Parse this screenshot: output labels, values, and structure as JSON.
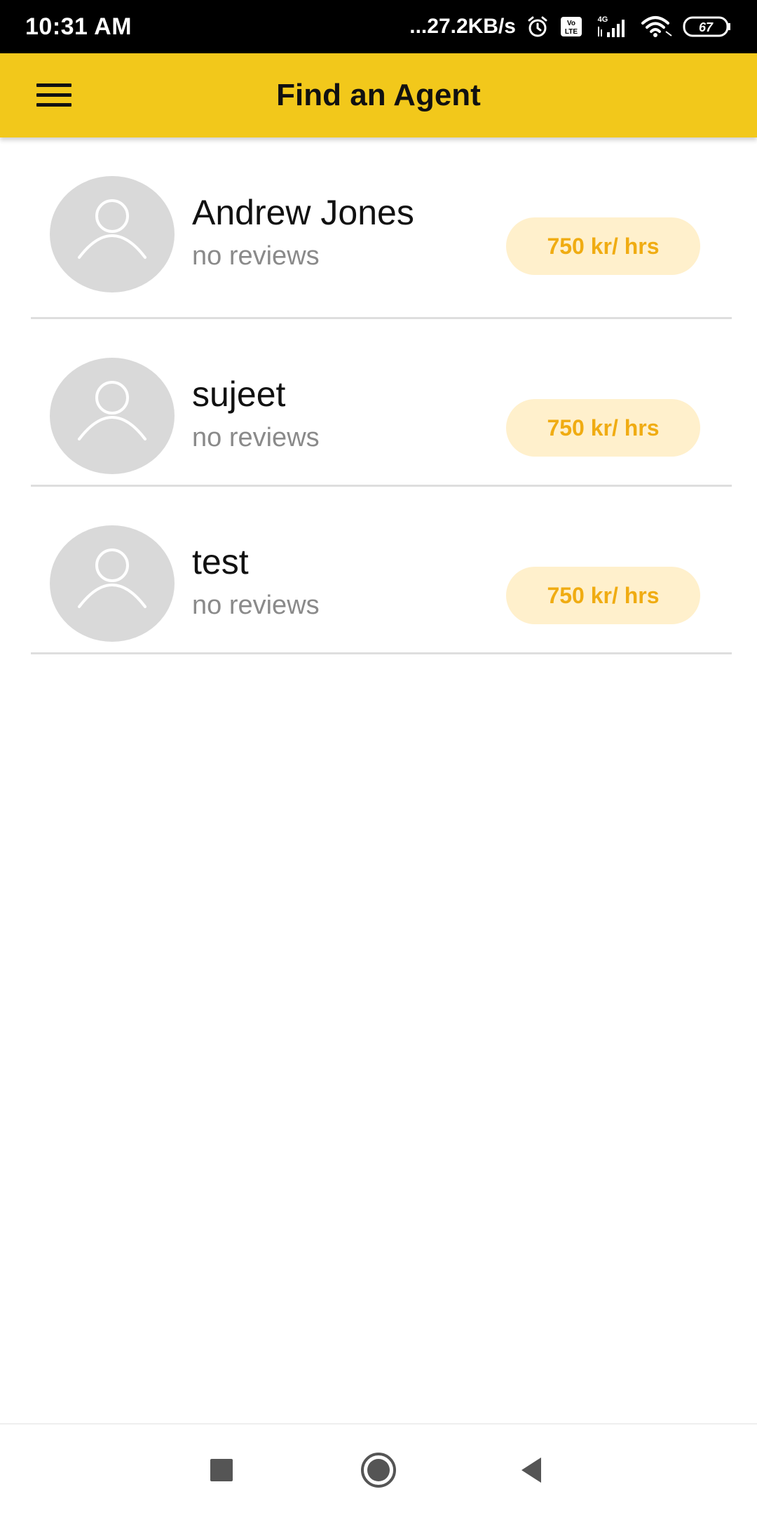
{
  "status_bar": {
    "time": "10:31 AM",
    "network_speed": "...27.2KB/s",
    "network_type": "4G",
    "volte_label": "Vo LTE",
    "battery_level": "67",
    "icons": [
      "alarm-icon",
      "volte-icon",
      "signal-icon",
      "wifi-icon",
      "battery-icon"
    ]
  },
  "app_bar": {
    "title": "Find an Agent",
    "menu_icon": "hamburger-menu-icon",
    "background_color": "#f2c81b"
  },
  "agents": [
    {
      "name": "Andrew Jones",
      "reviews": "no reviews",
      "rate": "750 kr/ hrs"
    },
    {
      "name": "sujeet",
      "reviews": "no reviews",
      "rate": "750 kr/ hrs"
    },
    {
      "name": "test",
      "reviews": "no reviews",
      "rate": "750 kr/ hrs"
    }
  ],
  "nav_bar": {
    "icons": [
      "recents-square-icon",
      "home-circle-icon",
      "back-triangle-icon"
    ]
  },
  "colors": {
    "accent": "#f2c81b",
    "rate_text": "#f0ac12",
    "rate_badge_bg": "#fff0cc",
    "avatar_bg": "#d9d9d9"
  }
}
